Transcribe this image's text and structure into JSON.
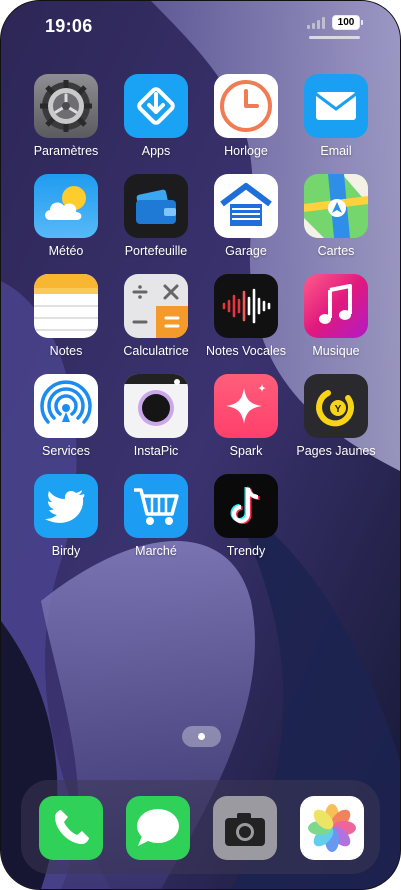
{
  "status_bar": {
    "time": "19:06",
    "battery": "100"
  },
  "apps": [
    {
      "label": "Paramètres",
      "icon": "settings-gear-icon"
    },
    {
      "label": "Apps",
      "icon": "app-store-icon"
    },
    {
      "label": "Horloge",
      "icon": "clock-icon"
    },
    {
      "label": "Email",
      "icon": "mail-envelope-icon"
    },
    {
      "label": "Météo",
      "icon": "weather-icon"
    },
    {
      "label": "Portefeuille",
      "icon": "wallet-icon"
    },
    {
      "label": "Garage",
      "icon": "garage-icon"
    },
    {
      "label": "Cartes",
      "icon": "maps-icon"
    },
    {
      "label": "Notes",
      "icon": "notes-icon"
    },
    {
      "label": "Calculatrice",
      "icon": "calculator-icon"
    },
    {
      "label": "Notes Vocales",
      "icon": "voice-memos-icon"
    },
    {
      "label": "Musique",
      "icon": "music-icon"
    },
    {
      "label": "Services",
      "icon": "services-broadcast-icon"
    },
    {
      "label": "InstaPic",
      "icon": "camera-app-icon"
    },
    {
      "label": "Spark",
      "icon": "sparkle-icon"
    },
    {
      "label": "Pages Jaunes",
      "icon": "pages-jaunes-icon"
    },
    {
      "label": "Birdy",
      "icon": "bird-icon"
    },
    {
      "label": "Marché",
      "icon": "shopping-cart-icon"
    },
    {
      "label": "Trendy",
      "icon": "tiktok-note-icon"
    }
  ],
  "dock": [
    {
      "name": "phone",
      "icon": "phone-icon"
    },
    {
      "name": "messages",
      "icon": "messages-icon"
    },
    {
      "name": "camera",
      "icon": "camera-icon"
    },
    {
      "name": "photos",
      "icon": "photos-icon"
    }
  ],
  "page_indicator": {
    "pages": 1,
    "current": 1
  }
}
